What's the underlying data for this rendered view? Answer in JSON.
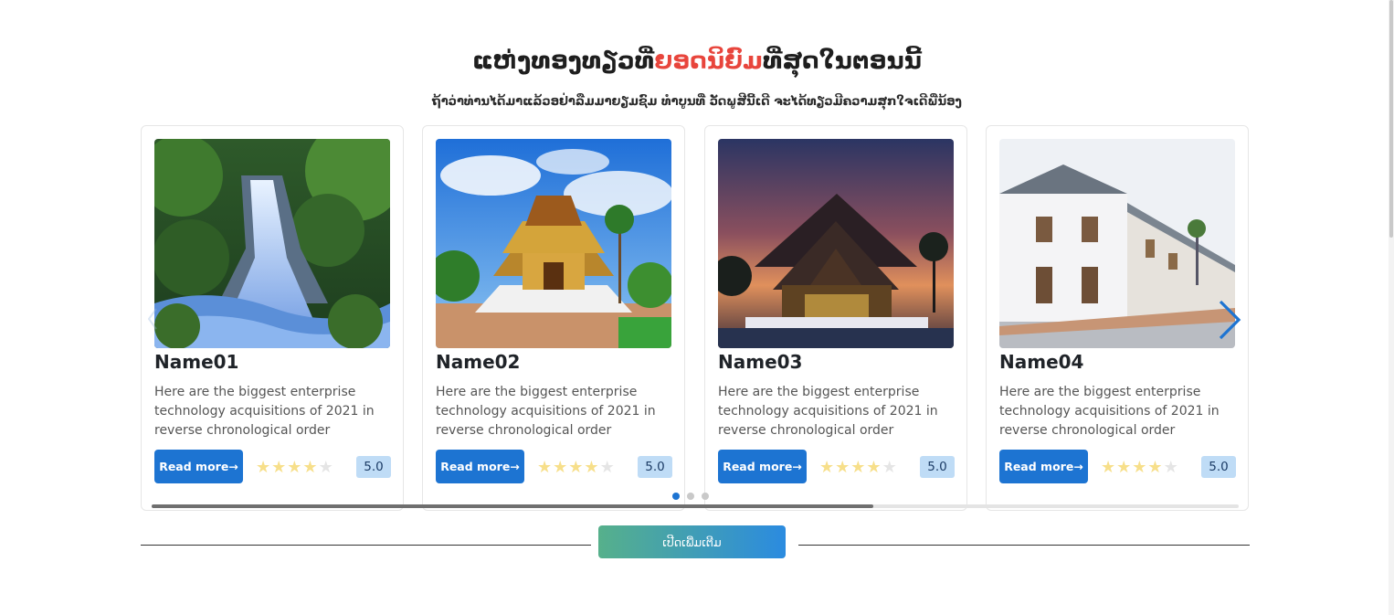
{
  "heading": {
    "part1": "ແຫ່ງທອງທຽວທີ່",
    "highlight": "ຍອດນິຍົມ",
    "part2": "ທີ່ສຸດໃນຕອນນີ້"
  },
  "subheading": "ຖ້າວ່າທ່ານໄດ້ມາແລ້ວອຢ່າລືມມາຍຽມຊົມ ທຳບູນທີ່ ວັດພູສີນີ້ເດີ ຈະໄດ້ທຽວມີຄວາມສຸກໃຈເດີພີ່ນ້ອງ",
  "cards": [
    {
      "name": "Name01",
      "image_icon": "waterfall-photo",
      "description": "Here are the biggest enterprise technology acquisitions of 2021 in reverse chronological order",
      "button": "Read more",
      "rating": "5.0",
      "stars_filled": 4,
      "stars_total": 5
    },
    {
      "name": "Name02",
      "image_icon": "temple-photo",
      "description": "Here are the biggest enterprise technology acquisitions of 2021 in reverse chronological order",
      "button": "Read more",
      "rating": "5.0",
      "stars_filled": 4,
      "stars_total": 5
    },
    {
      "name": "Name03",
      "image_icon": "temple-sunset-photo",
      "description": "Here are the biggest enterprise technology acquisitions of 2021 in reverse chronological order",
      "button": "Read more",
      "rating": "5.0",
      "stars_filled": 4,
      "stars_total": 5
    },
    {
      "name": "Name04",
      "image_icon": "street-photo",
      "description": "Here are the biggest enterprise technology acquisitions of 2021 in reverse chronological order",
      "button": "Read more",
      "rating": "5.0",
      "stars_filled": 4,
      "stars_total": 5
    }
  ],
  "slider": {
    "dots_total": 3,
    "active_dot": 1,
    "scroll_progress": 0.664,
    "next_icon": "chevron-right-icon",
    "prev_icon": "chevron-left-icon"
  },
  "more_button": "ເປີດເພີ່ມເຕີມ",
  "colors": {
    "highlight": "#e8453c",
    "primary": "#1d74d2",
    "rating_bg": "#bfdcf6",
    "star": "#f7df8a",
    "gradient_start": "#56b08b",
    "gradient_end": "#2b8be0"
  }
}
